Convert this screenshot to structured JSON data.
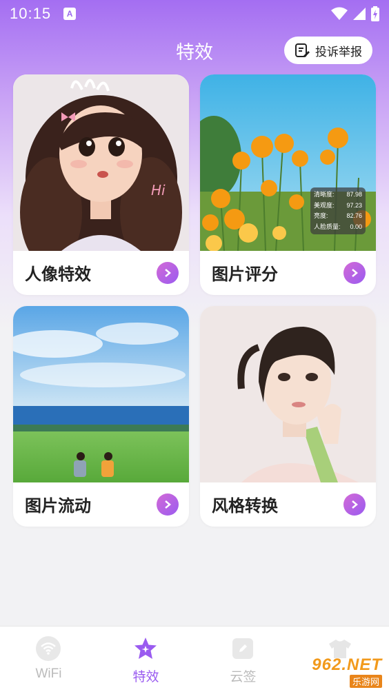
{
  "status_bar": {
    "time": "10:15",
    "a_badge": "A"
  },
  "header": {
    "title": "特效",
    "report_label": "投诉举报"
  },
  "cards": [
    {
      "label": "人像特效",
      "image": "cartoon-girl-portrait",
      "hi_text": "Hi"
    },
    {
      "label": "图片评分",
      "image": "orange-poppies-field",
      "scores": [
        {
          "name": "清晰度:",
          "value": "87.98"
        },
        {
          "name": "美观度:",
          "value": "97.23"
        },
        {
          "name": "亮度:",
          "value": "82.76"
        },
        {
          "name": "人脸质量:",
          "value": "0.00"
        }
      ]
    },
    {
      "label": "图片流动",
      "image": "couple-on-lawn-by-sea"
    },
    {
      "label": "风格转换",
      "image": "painted-woman-portrait"
    }
  ],
  "tabbar": {
    "tabs": [
      {
        "label": "WiFi",
        "icon": "wifi-icon",
        "active": false
      },
      {
        "label": "特效",
        "icon": "sparkle-star-icon",
        "active": true
      },
      {
        "label": "云签",
        "icon": "pencil-icon",
        "active": false
      },
      {
        "label": "",
        "icon": "shirt-icon",
        "active": false
      }
    ]
  },
  "watermark": {
    "top": "962.NET",
    "bottom": "乐游网"
  },
  "colors": {
    "accent": "#9a5bf0",
    "gradient_top": "#a46ef2"
  }
}
